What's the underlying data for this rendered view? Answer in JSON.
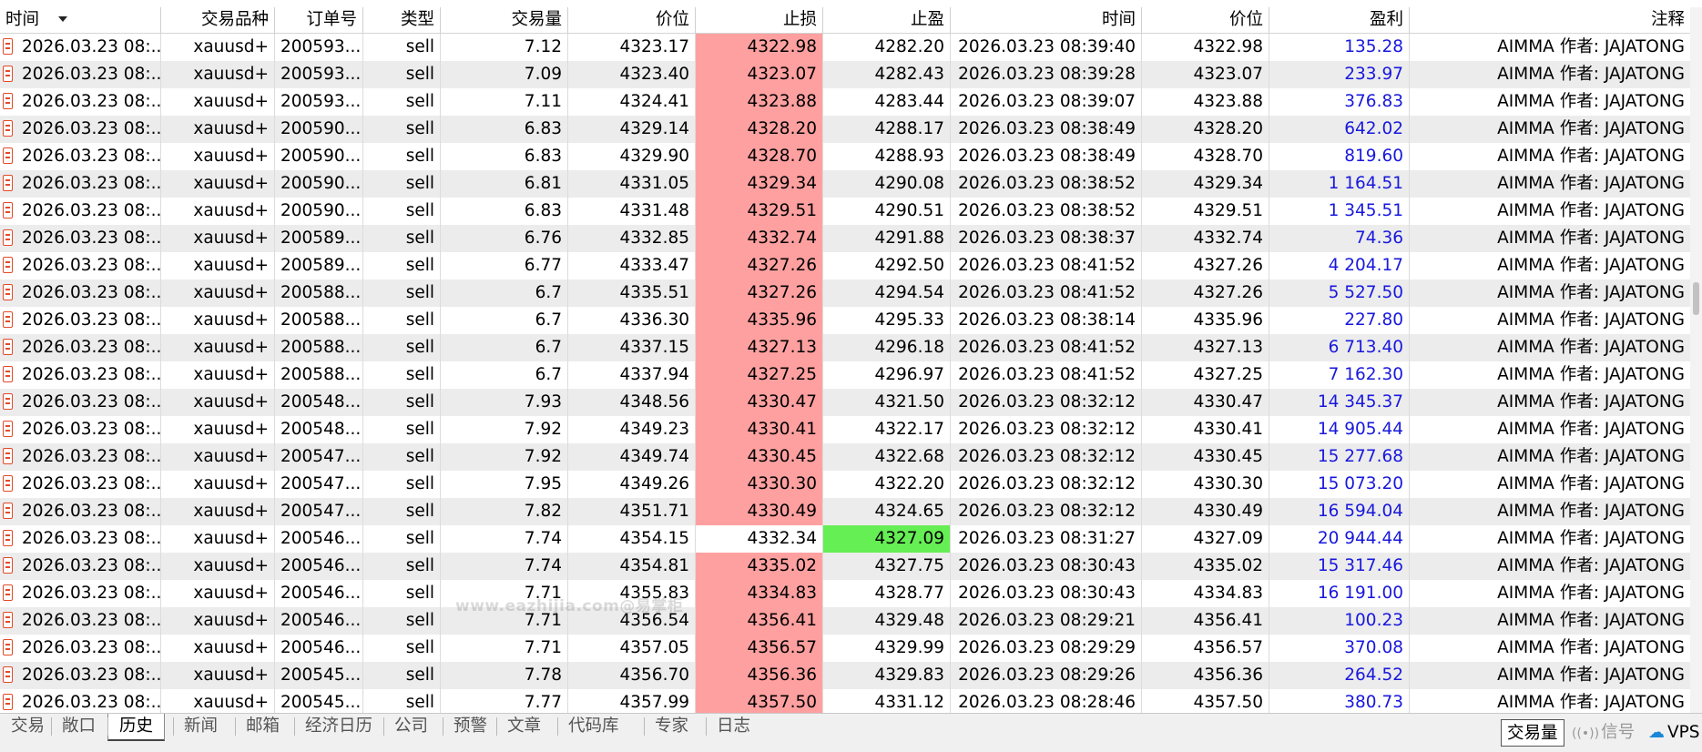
{
  "columns": {
    "open_time": "时间",
    "symbol": "交易品种",
    "ticket": "订单号",
    "type": "类型",
    "volume": "交易量",
    "open_price": "价位",
    "sl": "止损",
    "tp": "止盈",
    "close_time": "时间",
    "close_price": "价位",
    "profit": "盈利",
    "comment": "注释"
  },
  "rows": [
    {
      "open_time": "2026.03.23 08:...",
      "symbol": "xauusd+",
      "ticket": "200593...",
      "type": "sell",
      "volume": "7.12",
      "open_price": "4323.17",
      "sl": "4322.98",
      "tp": "4282.20",
      "close_time": "2026.03.23 08:39:40",
      "close_price": "4322.98",
      "profit": "135.28",
      "comment": "AIMMA 作者: JAJATONG",
      "hit": "sl"
    },
    {
      "open_time": "2026.03.23 08:...",
      "symbol": "xauusd+",
      "ticket": "200593...",
      "type": "sell",
      "volume": "7.09",
      "open_price": "4323.40",
      "sl": "4323.07",
      "tp": "4282.43",
      "close_time": "2026.03.23 08:39:28",
      "close_price": "4323.07",
      "profit": "233.97",
      "comment": "AIMMA 作者: JAJATONG",
      "hit": "sl"
    },
    {
      "open_time": "2026.03.23 08:...",
      "symbol": "xauusd+",
      "ticket": "200593...",
      "type": "sell",
      "volume": "7.11",
      "open_price": "4324.41",
      "sl": "4323.88",
      "tp": "4283.44",
      "close_time": "2026.03.23 08:39:07",
      "close_price": "4323.88",
      "profit": "376.83",
      "comment": "AIMMA 作者: JAJATONG",
      "hit": "sl"
    },
    {
      "open_time": "2026.03.23 08:...",
      "symbol": "xauusd+",
      "ticket": "200590...",
      "type": "sell",
      "volume": "6.83",
      "open_price": "4329.14",
      "sl": "4328.20",
      "tp": "4288.17",
      "close_time": "2026.03.23 08:38:49",
      "close_price": "4328.20",
      "profit": "642.02",
      "comment": "AIMMA 作者: JAJATONG",
      "hit": "sl"
    },
    {
      "open_time": "2026.03.23 08:...",
      "symbol": "xauusd+",
      "ticket": "200590...",
      "type": "sell",
      "volume": "6.83",
      "open_price": "4329.90",
      "sl": "4328.70",
      "tp": "4288.93",
      "close_time": "2026.03.23 08:38:49",
      "close_price": "4328.70",
      "profit": "819.60",
      "comment": "AIMMA 作者: JAJATONG",
      "hit": "sl"
    },
    {
      "open_time": "2026.03.23 08:...",
      "symbol": "xauusd+",
      "ticket": "200590...",
      "type": "sell",
      "volume": "6.81",
      "open_price": "4331.05",
      "sl": "4329.34",
      "tp": "4290.08",
      "close_time": "2026.03.23 08:38:52",
      "close_price": "4329.34",
      "profit": "1 164.51",
      "comment": "AIMMA 作者: JAJATONG",
      "hit": "sl"
    },
    {
      "open_time": "2026.03.23 08:...",
      "symbol": "xauusd+",
      "ticket": "200590...",
      "type": "sell",
      "volume": "6.83",
      "open_price": "4331.48",
      "sl": "4329.51",
      "tp": "4290.51",
      "close_time": "2026.03.23 08:38:52",
      "close_price": "4329.51",
      "profit": "1 345.51",
      "comment": "AIMMA 作者: JAJATONG",
      "hit": "sl"
    },
    {
      "open_time": "2026.03.23 08:...",
      "symbol": "xauusd+",
      "ticket": "200589...",
      "type": "sell",
      "volume": "6.76",
      "open_price": "4332.85",
      "sl": "4332.74",
      "tp": "4291.88",
      "close_time": "2026.03.23 08:38:37",
      "close_price": "4332.74",
      "profit": "74.36",
      "comment": "AIMMA 作者: JAJATONG",
      "hit": "sl"
    },
    {
      "open_time": "2026.03.23 08:...",
      "symbol": "xauusd+",
      "ticket": "200589...",
      "type": "sell",
      "volume": "6.77",
      "open_price": "4333.47",
      "sl": "4327.26",
      "tp": "4292.50",
      "close_time": "2026.03.23 08:41:52",
      "close_price": "4327.26",
      "profit": "4 204.17",
      "comment": "AIMMA 作者: JAJATONG",
      "hit": "sl"
    },
    {
      "open_time": "2026.03.23 08:...",
      "symbol": "xauusd+",
      "ticket": "200588...",
      "type": "sell",
      "volume": "6.7",
      "open_price": "4335.51",
      "sl": "4327.26",
      "tp": "4294.54",
      "close_time": "2026.03.23 08:41:52",
      "close_price": "4327.26",
      "profit": "5 527.50",
      "comment": "AIMMA 作者: JAJATONG",
      "hit": "sl"
    },
    {
      "open_time": "2026.03.23 08:...",
      "symbol": "xauusd+",
      "ticket": "200588...",
      "type": "sell",
      "volume": "6.7",
      "open_price": "4336.30",
      "sl": "4335.96",
      "tp": "4295.33",
      "close_time": "2026.03.23 08:38:14",
      "close_price": "4335.96",
      "profit": "227.80",
      "comment": "AIMMA 作者: JAJATONG",
      "hit": "sl"
    },
    {
      "open_time": "2026.03.23 08:...",
      "symbol": "xauusd+",
      "ticket": "200588...",
      "type": "sell",
      "volume": "6.7",
      "open_price": "4337.15",
      "sl": "4327.13",
      "tp": "4296.18",
      "close_time": "2026.03.23 08:41:52",
      "close_price": "4327.13",
      "profit": "6 713.40",
      "comment": "AIMMA 作者: JAJATONG",
      "hit": "sl"
    },
    {
      "open_time": "2026.03.23 08:...",
      "symbol": "xauusd+",
      "ticket": "200588...",
      "type": "sell",
      "volume": "6.7",
      "open_price": "4337.94",
      "sl": "4327.25",
      "tp": "4296.97",
      "close_time": "2026.03.23 08:41:52",
      "close_price": "4327.25",
      "profit": "7 162.30",
      "comment": "AIMMA 作者: JAJATONG",
      "hit": "sl"
    },
    {
      "open_time": "2026.03.23 08:...",
      "symbol": "xauusd+",
      "ticket": "200548...",
      "type": "sell",
      "volume": "7.93",
      "open_price": "4348.56",
      "sl": "4330.47",
      "tp": "4321.50",
      "close_time": "2026.03.23 08:32:12",
      "close_price": "4330.47",
      "profit": "14 345.37",
      "comment": "AIMMA 作者: JAJATONG",
      "hit": "sl"
    },
    {
      "open_time": "2026.03.23 08:...",
      "symbol": "xauusd+",
      "ticket": "200548...",
      "type": "sell",
      "volume": "7.92",
      "open_price": "4349.23",
      "sl": "4330.41",
      "tp": "4322.17",
      "close_time": "2026.03.23 08:32:12",
      "close_price": "4330.41",
      "profit": "14 905.44",
      "comment": "AIMMA 作者: JAJATONG",
      "hit": "sl"
    },
    {
      "open_time": "2026.03.23 08:...",
      "symbol": "xauusd+",
      "ticket": "200547...",
      "type": "sell",
      "volume": "7.92",
      "open_price": "4349.74",
      "sl": "4330.45",
      "tp": "4322.68",
      "close_time": "2026.03.23 08:32:12",
      "close_price": "4330.45",
      "profit": "15 277.68",
      "comment": "AIMMA 作者: JAJATONG",
      "hit": "sl"
    },
    {
      "open_time": "2026.03.23 08:...",
      "symbol": "xauusd+",
      "ticket": "200547...",
      "type": "sell",
      "volume": "7.95",
      "open_price": "4349.26",
      "sl": "4330.30",
      "tp": "4322.20",
      "close_time": "2026.03.23 08:32:12",
      "close_price": "4330.30",
      "profit": "15 073.20",
      "comment": "AIMMA 作者: JAJATONG",
      "hit": "sl"
    },
    {
      "open_time": "2026.03.23 08:...",
      "symbol": "xauusd+",
      "ticket": "200547...",
      "type": "sell",
      "volume": "7.82",
      "open_price": "4351.71",
      "sl": "4330.49",
      "tp": "4324.65",
      "close_time": "2026.03.23 08:32:12",
      "close_price": "4330.49",
      "profit": "16 594.04",
      "comment": "AIMMA 作者: JAJATONG",
      "hit": "sl"
    },
    {
      "open_time": "2026.03.23 08:...",
      "symbol": "xauusd+",
      "ticket": "200546...",
      "type": "sell",
      "volume": "7.74",
      "open_price": "4354.15",
      "sl": "4332.34",
      "tp": "4327.09",
      "close_time": "2026.03.23 08:31:27",
      "close_price": "4327.09",
      "profit": "20 944.44",
      "comment": "AIMMA 作者: JAJATONG",
      "hit": "tp"
    },
    {
      "open_time": "2026.03.23 08:...",
      "symbol": "xauusd+",
      "ticket": "200546...",
      "type": "sell",
      "volume": "7.74",
      "open_price": "4354.81",
      "sl": "4335.02",
      "tp": "4327.75",
      "close_time": "2026.03.23 08:30:43",
      "close_price": "4335.02",
      "profit": "15 317.46",
      "comment": "AIMMA 作者: JAJATONG",
      "hit": "sl"
    },
    {
      "open_time": "2026.03.23 08:...",
      "symbol": "xauusd+",
      "ticket": "200546...",
      "type": "sell",
      "volume": "7.71",
      "open_price": "4355.83",
      "sl": "4334.83",
      "tp": "4328.77",
      "close_time": "2026.03.23 08:30:43",
      "close_price": "4334.83",
      "profit": "16 191.00",
      "comment": "AIMMA 作者: JAJATONG",
      "hit": "sl"
    },
    {
      "open_time": "2026.03.23 08:...",
      "symbol": "xauusd+",
      "ticket": "200546...",
      "type": "sell",
      "volume": "7.71",
      "open_price": "4356.54",
      "sl": "4356.41",
      "tp": "4329.48",
      "close_time": "2026.03.23 08:29:21",
      "close_price": "4356.41",
      "profit": "100.23",
      "comment": "AIMMA 作者: JAJATONG",
      "hit": "sl"
    },
    {
      "open_time": "2026.03.23 08:...",
      "symbol": "xauusd+",
      "ticket": "200546...",
      "type": "sell",
      "volume": "7.71",
      "open_price": "4357.05",
      "sl": "4356.57",
      "tp": "4329.99",
      "close_time": "2026.03.23 08:29:29",
      "close_price": "4356.57",
      "profit": "370.08",
      "comment": "AIMMA 作者: JAJATONG",
      "hit": "sl"
    },
    {
      "open_time": "2026.03.23 08:...",
      "symbol": "xauusd+",
      "ticket": "200545...",
      "type": "sell",
      "volume": "7.78",
      "open_price": "4356.70",
      "sl": "4356.36",
      "tp": "4329.83",
      "close_time": "2026.03.23 08:29:26",
      "close_price": "4356.36",
      "profit": "264.52",
      "comment": "AIMMA 作者: JAJATONG",
      "hit": "sl"
    },
    {
      "open_time": "2026.03.23 08:...",
      "symbol": "xauusd+",
      "ticket": "200545...",
      "type": "sell",
      "volume": "7.77",
      "open_price": "4357.99",
      "sl": "4357.50",
      "tp": "4331.12",
      "close_time": "2026.03.23 08:28:46",
      "close_price": "4357.50",
      "profit": "380.73",
      "comment": "AIMMA 作者: JAJATONG",
      "hit": "sl"
    }
  ],
  "watermark": "www.eazhijia.com@易掌柜",
  "tabs": [
    "交易",
    "敞口",
    "历史",
    "新闻",
    "邮箱",
    "经济日历",
    "公司",
    "预警",
    "文章",
    "代码库",
    "专家",
    "日志"
  ],
  "active_tab": "历史",
  "status": {
    "volume_label": "交易量",
    "signal_label": "信号",
    "vps_label": "VPS"
  },
  "colors": {
    "sl_hit": "#ffa0a0",
    "tp_hit": "#66ee55",
    "profit_text": "#1818dd",
    "alt_row": "#ececec"
  },
  "icons": {
    "row_icon": "order-document-icon",
    "sort": "sort-desc-arrow-icon",
    "signal": "signal-broadcast-icon",
    "vps": "cloud-icon"
  }
}
